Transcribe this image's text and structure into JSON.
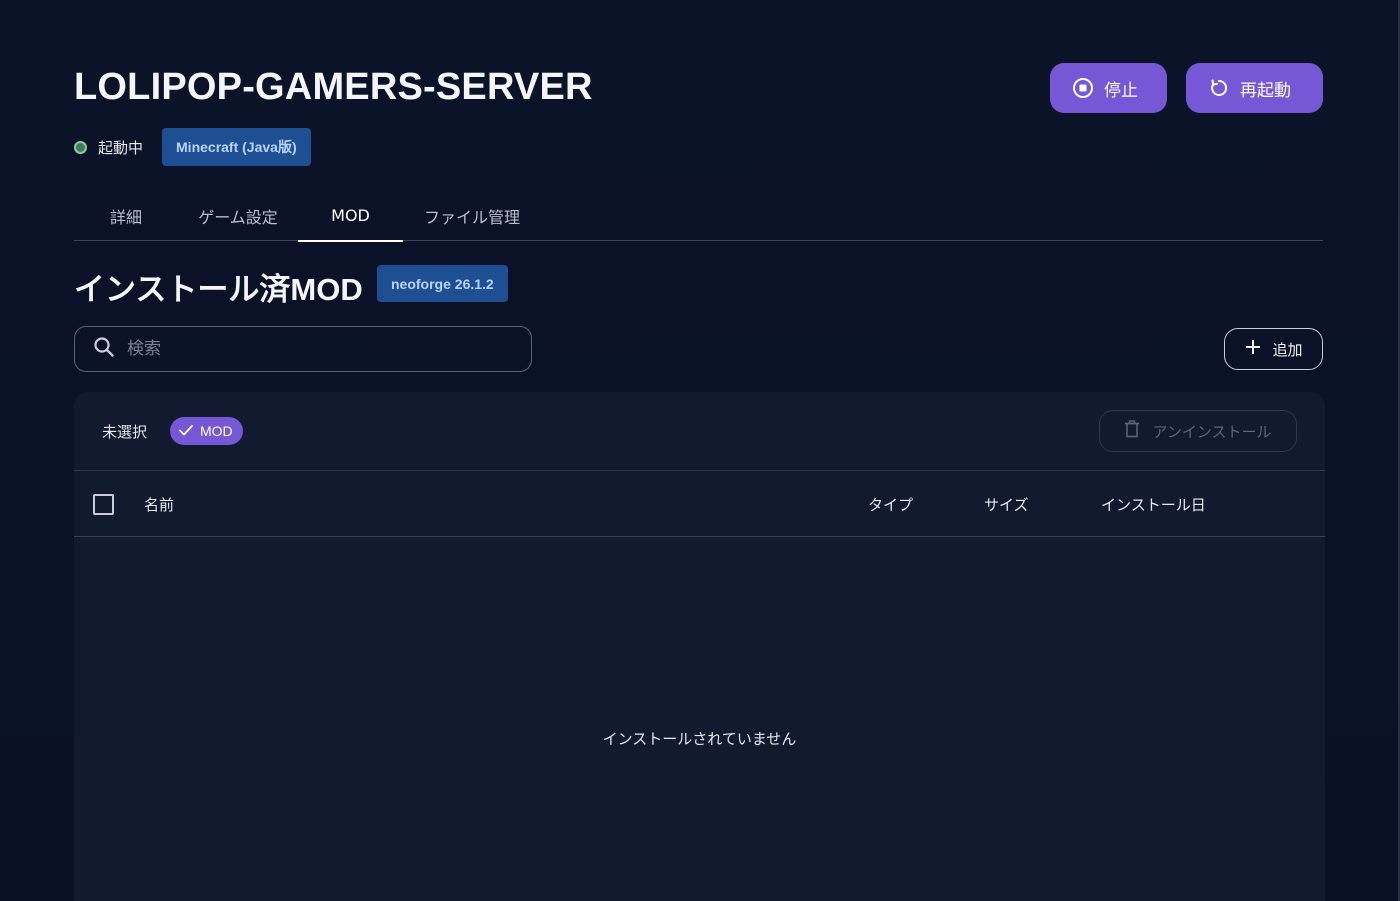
{
  "server": {
    "name": "LOLIPOP-GAMERS-SERVER",
    "status": "起動中",
    "game": "Minecraft (Java版)"
  },
  "actions": {
    "stop_label": "停止",
    "restart_label": "再起動"
  },
  "tabs": [
    {
      "label": "詳細",
      "active": false
    },
    {
      "label": "ゲーム設定",
      "active": false
    },
    {
      "label": "MOD",
      "active": true
    },
    {
      "label": "ファイル管理",
      "active": false
    }
  ],
  "section": {
    "title": "インストール済MOD",
    "version": "neoforge 26.1.2"
  },
  "search": {
    "placeholder": "検索"
  },
  "add_label": "追加",
  "toolbar": {
    "selection_text": "未選択",
    "filter_chip": "MOD",
    "uninstall_label": "アンインストール"
  },
  "table": {
    "columns": [
      "名前",
      "タイプ",
      "サイズ",
      "インストール日"
    ],
    "rows": [],
    "empty_message": "インストールされていません"
  },
  "colors": {
    "background": "#0a1128",
    "accent": "#7657d6",
    "badge": "#1f4f93",
    "panel": "#111a2e",
    "status_running": "#3f7b58"
  }
}
